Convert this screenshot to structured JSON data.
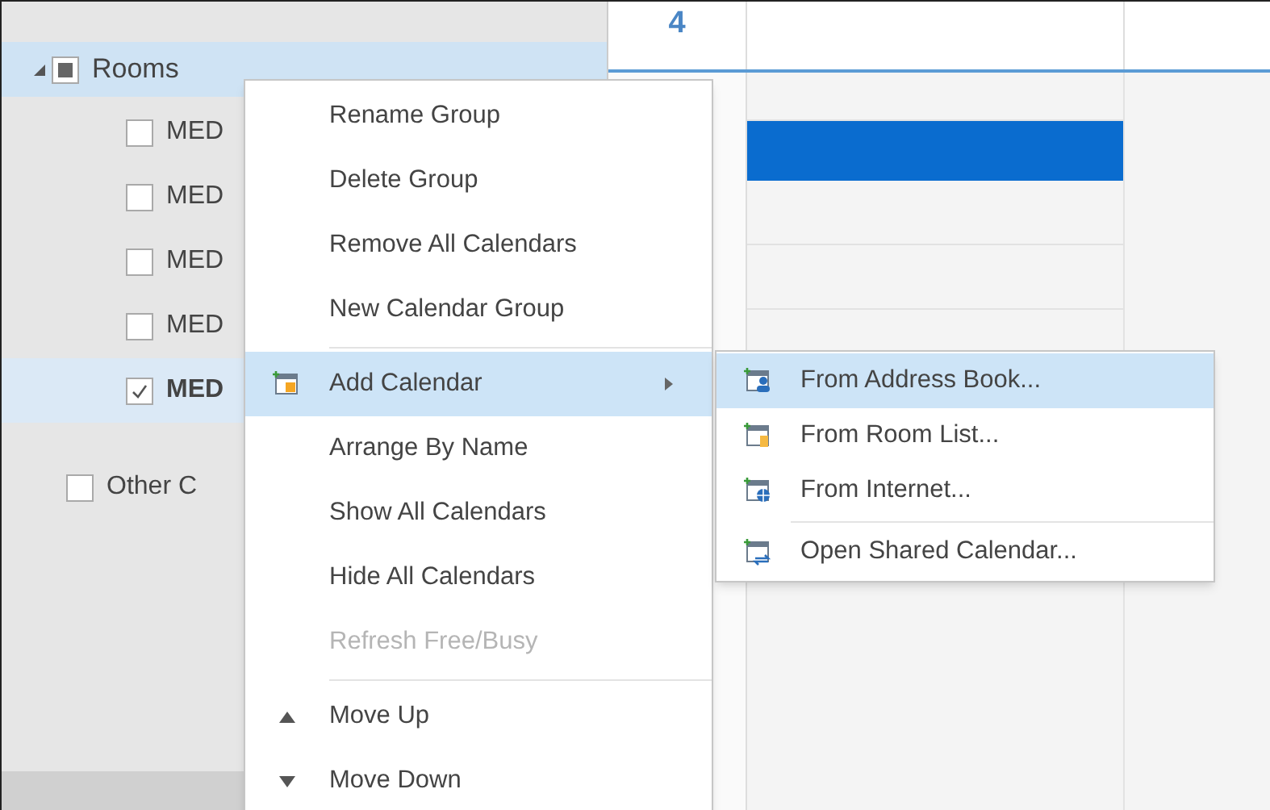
{
  "sidebar": {
    "group": {
      "label": "Rooms",
      "expanded": true,
      "mixed": true
    },
    "items": [
      {
        "label": "MED",
        "checked": false,
        "selected": false
      },
      {
        "label": "MED",
        "checked": false,
        "selected": false
      },
      {
        "label": "MED",
        "checked": false,
        "selected": false
      },
      {
        "label": "MED",
        "checked": false,
        "selected": false
      },
      {
        "label": "MED",
        "checked": true,
        "selected": true
      }
    ],
    "other_group": {
      "label": "Other C",
      "checked": false
    }
  },
  "calendar": {
    "day": "4"
  },
  "context_menu": [
    {
      "label": "Rename Group",
      "kind": "plain",
      "selected": false,
      "disabled": false,
      "separator_before": false,
      "submenu": false
    },
    {
      "label": "Delete Group",
      "kind": "plain",
      "selected": false,
      "disabled": false,
      "separator_before": false,
      "submenu": false
    },
    {
      "label": "Remove All Calendars",
      "kind": "plain",
      "selected": false,
      "disabled": false,
      "separator_before": false,
      "submenu": false
    },
    {
      "label": "New Calendar Group",
      "kind": "plain",
      "selected": false,
      "disabled": false,
      "separator_before": false,
      "submenu": false
    },
    {
      "label": "Add Calendar",
      "kind": "calendar",
      "selected": true,
      "disabled": false,
      "separator_before": true,
      "submenu": true
    },
    {
      "label": "Arrange By Name",
      "kind": "plain",
      "selected": false,
      "disabled": false,
      "separator_before": false,
      "submenu": false
    },
    {
      "label": "Show All Calendars",
      "kind": "plain",
      "selected": false,
      "disabled": false,
      "separator_before": false,
      "submenu": false
    },
    {
      "label": "Hide All Calendars",
      "kind": "plain",
      "selected": false,
      "disabled": false,
      "separator_before": false,
      "submenu": false
    },
    {
      "label": "Refresh Free/Busy",
      "kind": "plain",
      "selected": false,
      "disabled": true,
      "separator_before": false,
      "submenu": false
    },
    {
      "label": "Move Up",
      "kind": "up",
      "selected": false,
      "disabled": false,
      "separator_before": true,
      "submenu": false
    },
    {
      "label": "Move Down",
      "kind": "down",
      "selected": false,
      "disabled": false,
      "separator_before": false,
      "submenu": false
    }
  ],
  "submenu": [
    {
      "label": "From Address Book...",
      "kind": "person",
      "selected": true,
      "separator_before": false
    },
    {
      "label": "From Room List...",
      "kind": "room",
      "selected": false,
      "separator_before": false
    },
    {
      "label": "From Internet...",
      "kind": "globe",
      "selected": false,
      "separator_before": false
    },
    {
      "label": "Open Shared Calendar...",
      "kind": "shared",
      "selected": false,
      "separator_before": true
    }
  ]
}
